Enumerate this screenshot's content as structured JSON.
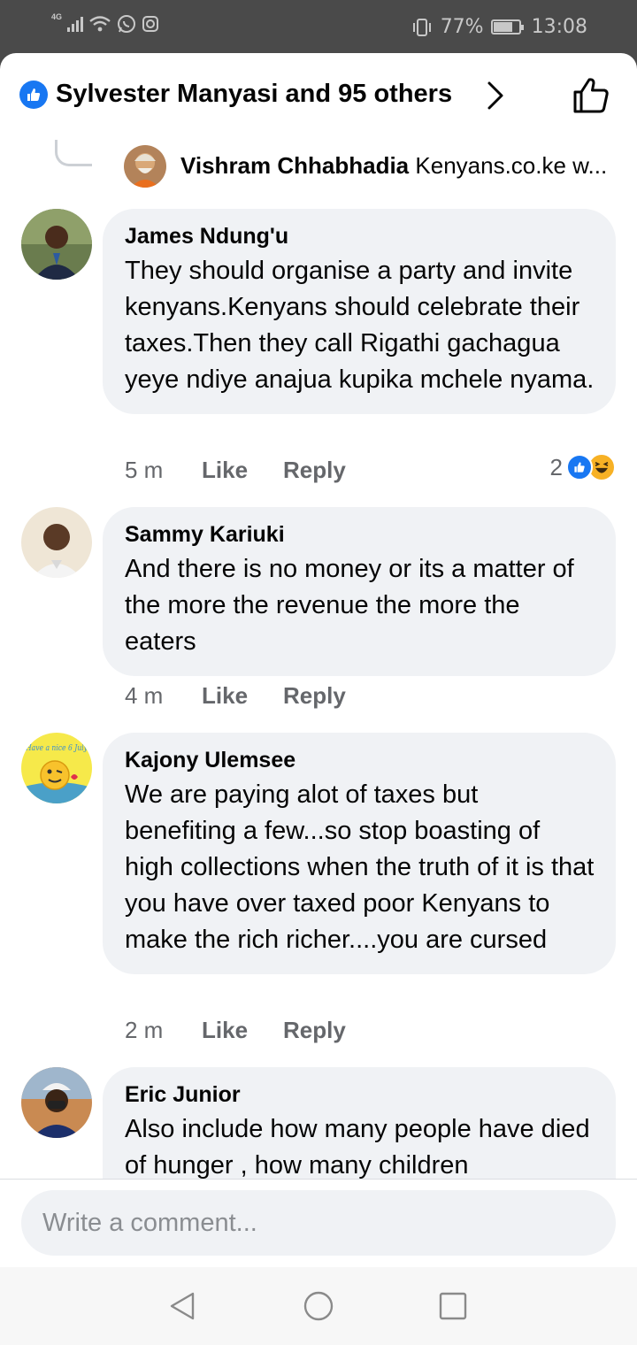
{
  "status_bar": {
    "network": "4G",
    "battery": "77%",
    "battery_level": 0.77,
    "time": "13:08"
  },
  "header": {
    "title": "Sylvester Manyasi and 95 others",
    "icons": [
      "like-badge-icon",
      "chevron-right-icon",
      "thumbs-up-outline-icon"
    ]
  },
  "reply_preview": {
    "author": "Vishram Chhabhadia",
    "snippet": "Kenyans.co.ke w..."
  },
  "comments": [
    {
      "author": "James Ndung'u",
      "text": "They should organise a party and invite kenyans.Kenyans should celebrate their taxes.Then they call Rigathi gachagua yeye ndiye anajua kupika mchele nyama.",
      "time": "5 m",
      "like": "Like",
      "reply": "Reply",
      "reaction_count": "2",
      "reactions": [
        "like",
        "haha"
      ]
    },
    {
      "author": "Sammy Kariuki",
      "text": "And there is no money or its a matter of the more the revenue the more the eaters",
      "time": "4 m",
      "like": "Like",
      "reply": "Reply"
    },
    {
      "author": "Kajony Ulemsee",
      "avatar_text": "Have a nice 6 July",
      "text": "We are paying alot of taxes but benefiting a few...so stop boasting of high collections when the truth of it is that you have over taxed poor Kenyans to make the rich richer....you are cursed",
      "time": "2 m",
      "like": "Like",
      "reply": "Reply"
    },
    {
      "author": "Eric Junior",
      "text": "Also include how many people have died of hunger , how many children"
    }
  ],
  "composer": {
    "placeholder": "Write a comment..."
  },
  "nav": [
    "back",
    "home",
    "recents"
  ],
  "colors": {
    "accent": "#1877f2",
    "bubble": "#f0f2f5",
    "secondary_text": "#65676b",
    "status_bar": "#4a4a4a"
  }
}
